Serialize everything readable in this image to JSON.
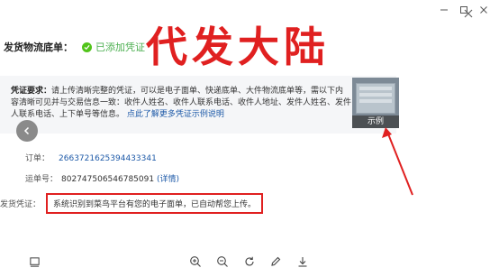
{
  "header": {
    "label": "发货物流底单：",
    "status": "已添加凭证"
  },
  "headline": "代发大陆",
  "requirements": {
    "title": "凭证要求：",
    "body": "请上传清晰完整的凭证，可以是电子面单、快递底单、大件物流底单等，需以下内容清晰可见并与交易信息一致：收件人姓名、收件人联系电话、收件人地址、发件人姓名、发件人联系电话、上下单号等信息。",
    "link": "点此了解更多凭证示例说明"
  },
  "sample": {
    "label": "示例"
  },
  "fields": {
    "order_label": "订单：",
    "order_value": "2663721625394433341",
    "waybill_label": "运单号：",
    "waybill_value": "802747506546785091",
    "waybill_detail": "(详情)"
  },
  "voucher": {
    "label": "发货凭证：",
    "message": "系统识别到菜鸟平台有您的电子面单，已自动帮您上传。"
  },
  "colors": {
    "accent_red": "#e02020",
    "link_blue": "#1e5aa8",
    "success_green": "#52c41a"
  },
  "icons": [
    "minimize-icon",
    "maximize-icon",
    "close-icon",
    "check-icon",
    "chevron-left-icon",
    "screen-icon",
    "zoom-in-icon",
    "zoom-out-icon",
    "rotate-icon",
    "edit-icon",
    "download-icon"
  ]
}
